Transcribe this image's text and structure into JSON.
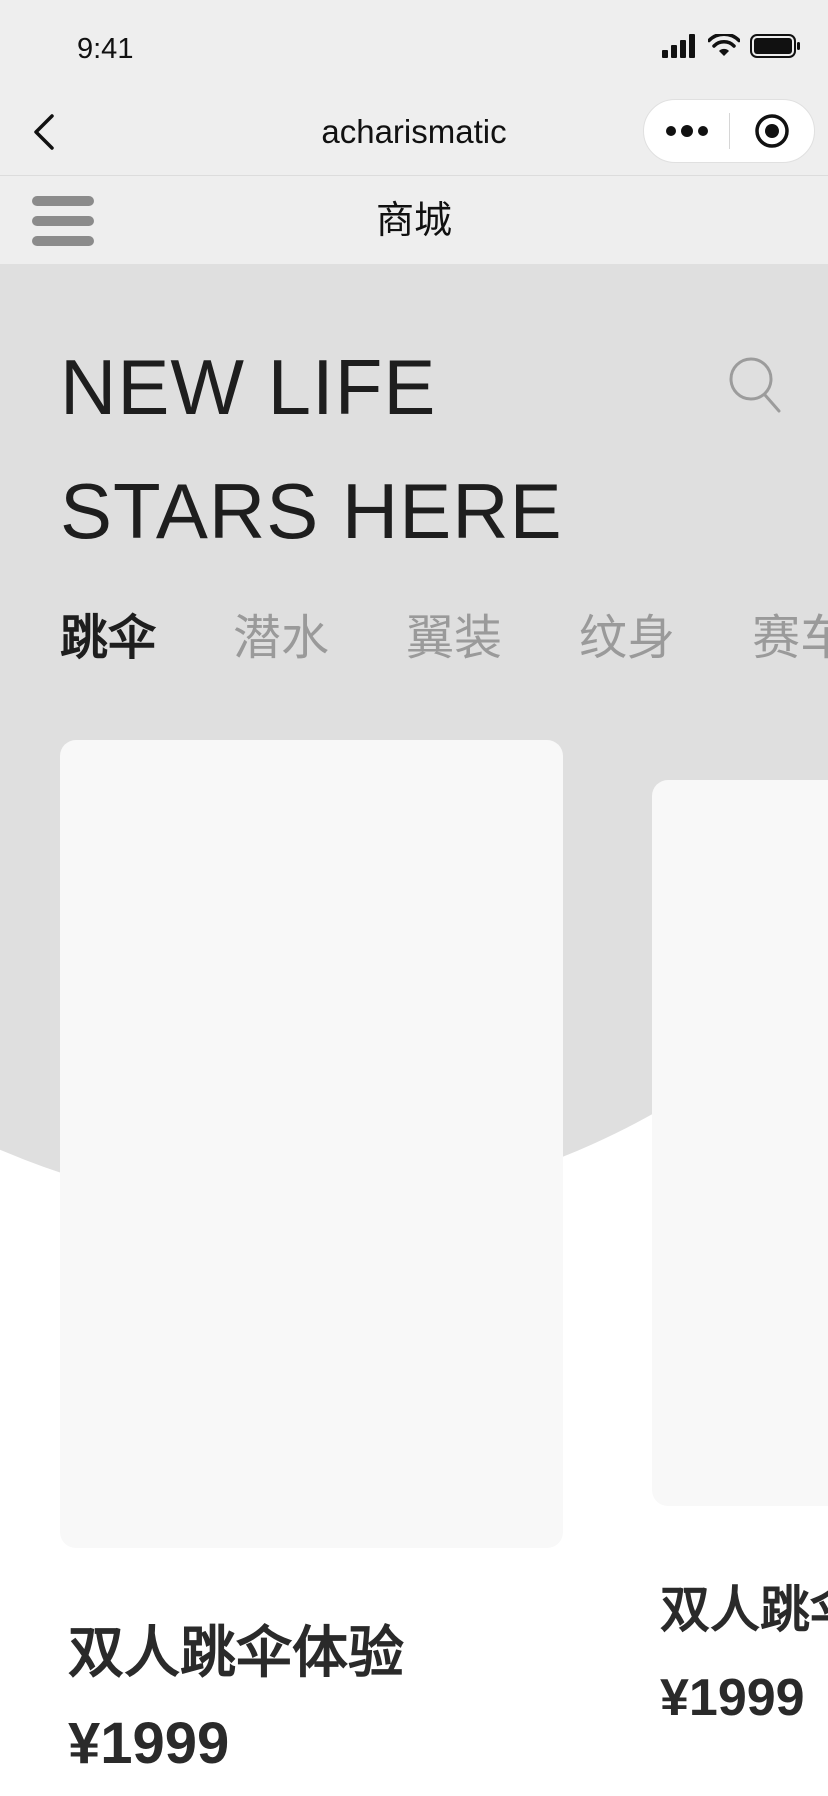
{
  "status_bar": {
    "time": "9:41",
    "icons": [
      "signal-icon",
      "wifi-icon",
      "battery-icon"
    ]
  },
  "nav": {
    "title": "acharismatic",
    "back_icon": "back-chevron-icon",
    "capsule": {
      "more_icon": "more-dots-icon",
      "close_icon": "target-close-icon"
    }
  },
  "subheader": {
    "title": "商城",
    "menu_icon": "hamburger-menu-icon"
  },
  "hero": {
    "line1": "NEW LIFE",
    "line2": "STARS HERE",
    "search_icon": "search-icon"
  },
  "tabs": [
    {
      "label": "跳伞",
      "active": true
    },
    {
      "label": "潜水",
      "active": false
    },
    {
      "label": "翼装",
      "active": false
    },
    {
      "label": "纹身",
      "active": false
    },
    {
      "label": "赛车",
      "active": false
    }
  ],
  "products": [
    {
      "name": "双人跳伞体验",
      "price": "¥1999"
    },
    {
      "name": "双人跳伞体验",
      "price": "¥1999"
    }
  ],
  "colors": {
    "chrome_bg": "#eeeeee",
    "hero_bg": "#dfdfdf",
    "card_bg": "#f8f8f8",
    "text_dark": "#1e1e1e",
    "tab_inactive": "#9a9a9a"
  }
}
